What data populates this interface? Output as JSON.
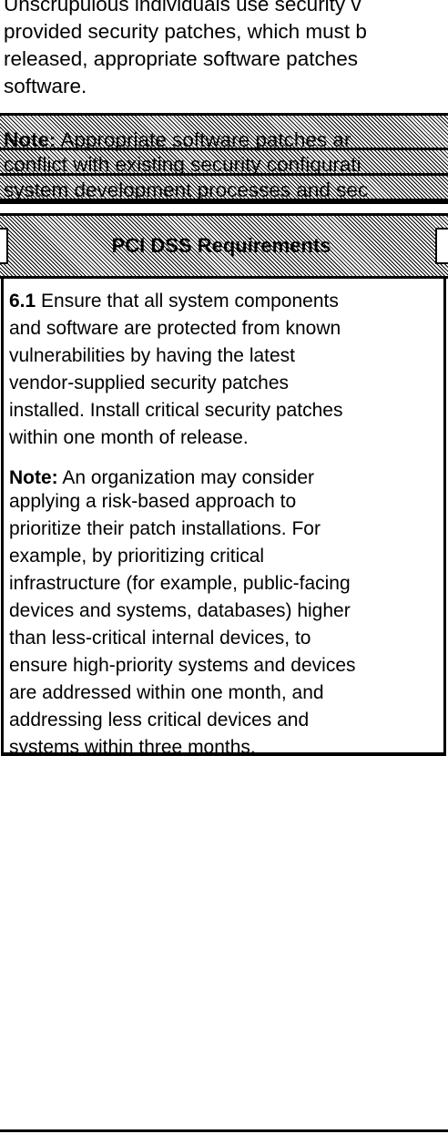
{
  "intro": {
    "lines": [
      "Unscrupulous individuals use security v",
      "provided security patches, which must b",
      "released, appropriate software patches",
      "software."
    ]
  },
  "note_box": {
    "label": "Note:",
    "lines": [
      " Appropriate software patches ar",
      "conflict with existing security configurati",
      "system development processes and sec"
    ]
  },
  "requirements": {
    "header": "PCI DSS Requirements",
    "req_6_1": {
      "number": "6.1",
      "lines": [
        " Ensure that all system components",
        "and software are protected from known",
        "vulnerabilities by having the latest",
        "vendor-supplied security patches",
        "installed. Install critical security patches",
        "within one month of release."
      ]
    },
    "note": {
      "label": "Note:",
      "lines": [
        " An organization may consider",
        "applying a risk-based approach to",
        "prioritize their patch installations. For",
        "example, by prioritizing critical",
        "infrastructure (for example, public-facing",
        "devices and systems, databases) higher",
        "than less-critical internal devices, to",
        "ensure high-priority systems and devices",
        "are addressed within one month, and",
        "addressing less critical devices and",
        "systems within three months."
      ]
    }
  }
}
